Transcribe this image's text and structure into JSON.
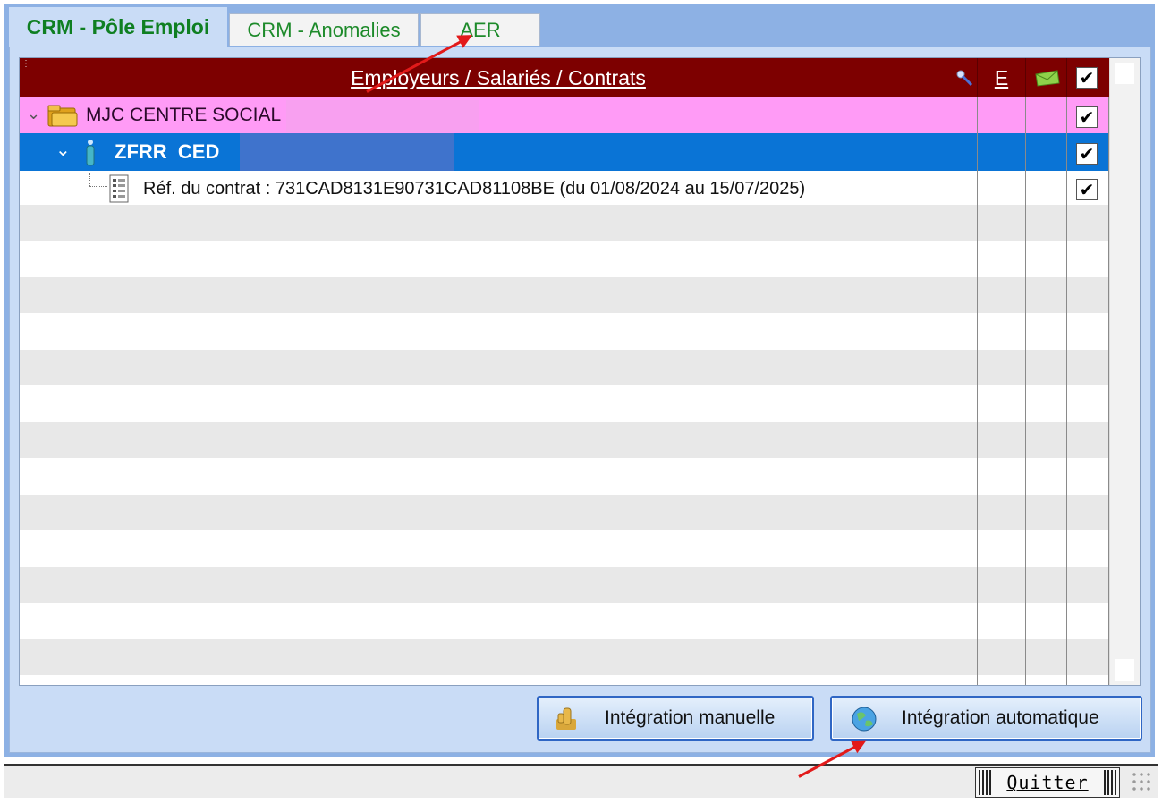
{
  "tabs": [
    {
      "label": "CRM - Pôle Emploi",
      "active": true
    },
    {
      "label": "CRM - Anomalies",
      "active": false
    },
    {
      "label": "AER",
      "active": false
    }
  ],
  "grid": {
    "header_title": "Employeurs / Salariés / Contrats",
    "header_e": "E",
    "rows": [
      {
        "label": "MJC CENTRE SOCIAL",
        "type": "employer",
        "checked": true
      },
      {
        "label": "ZFRR  CED",
        "type": "employee",
        "checked": true
      },
      {
        "label": "Réf. du contrat : 731CAD8131E90731CAD81108BE (du 01/08/2024 au 15/07/2025)",
        "type": "contract",
        "checked": true
      }
    ],
    "check_glyph": "✔"
  },
  "buttons": {
    "manual": "Intégration manuelle",
    "auto": "Intégration automatique"
  },
  "quit": "Quitter",
  "colors": {
    "header": "#7d0000",
    "employer_row": "#ff9bf6",
    "employee_row": "#0a74d6",
    "annotation_arrow": "#e21a1a"
  },
  "icons": [
    "key-icon",
    "mail-icon",
    "folder-icon",
    "person-icon",
    "contract-icon",
    "manual-integration-icon",
    "globe-icon"
  ]
}
